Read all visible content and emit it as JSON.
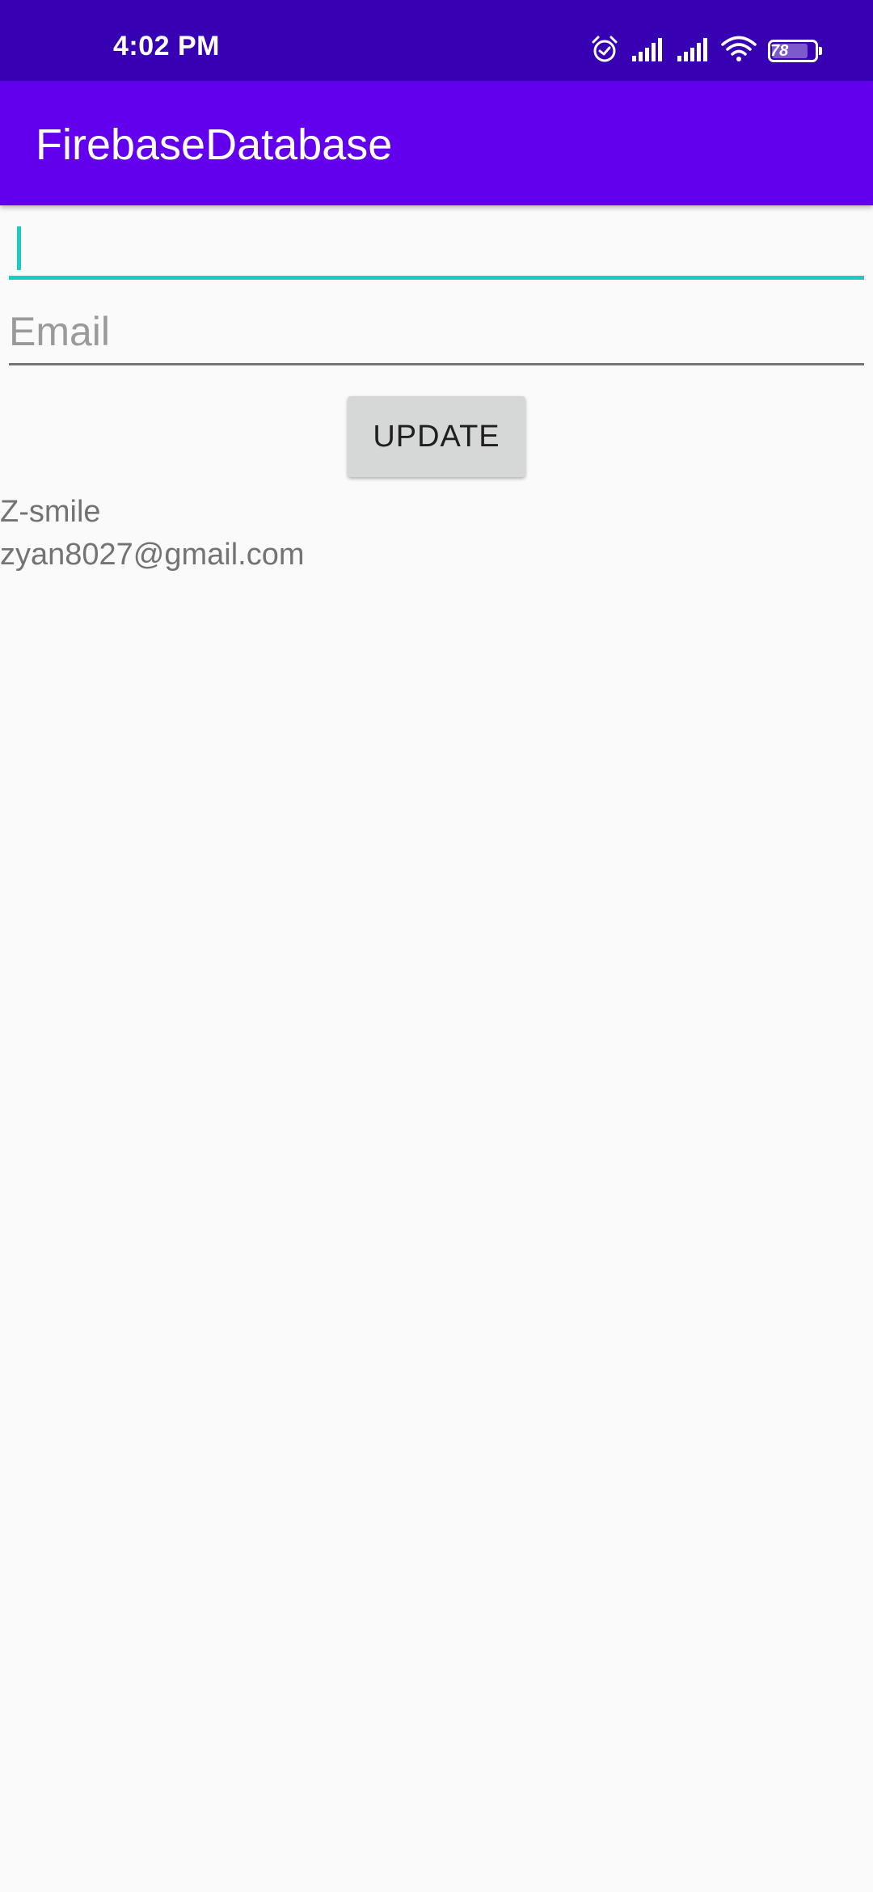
{
  "status_bar": {
    "time": "4:02 PM",
    "icons": [
      "alarm-icon",
      "signal-icon",
      "signal-icon",
      "wifi-icon"
    ],
    "battery_level": "78"
  },
  "app_bar": {
    "title": "FirebaseDatabase"
  },
  "form": {
    "name_value": "",
    "email_placeholder": "Email",
    "update_label": "UPDATE"
  },
  "result": {
    "name": "Z-smile",
    "email": "zyan8027@gmail.com"
  },
  "colors": {
    "status_bar": "#3700b3",
    "app_bar": "#6200ee",
    "accent": "#1ecbc0",
    "background": "#fafafa"
  }
}
